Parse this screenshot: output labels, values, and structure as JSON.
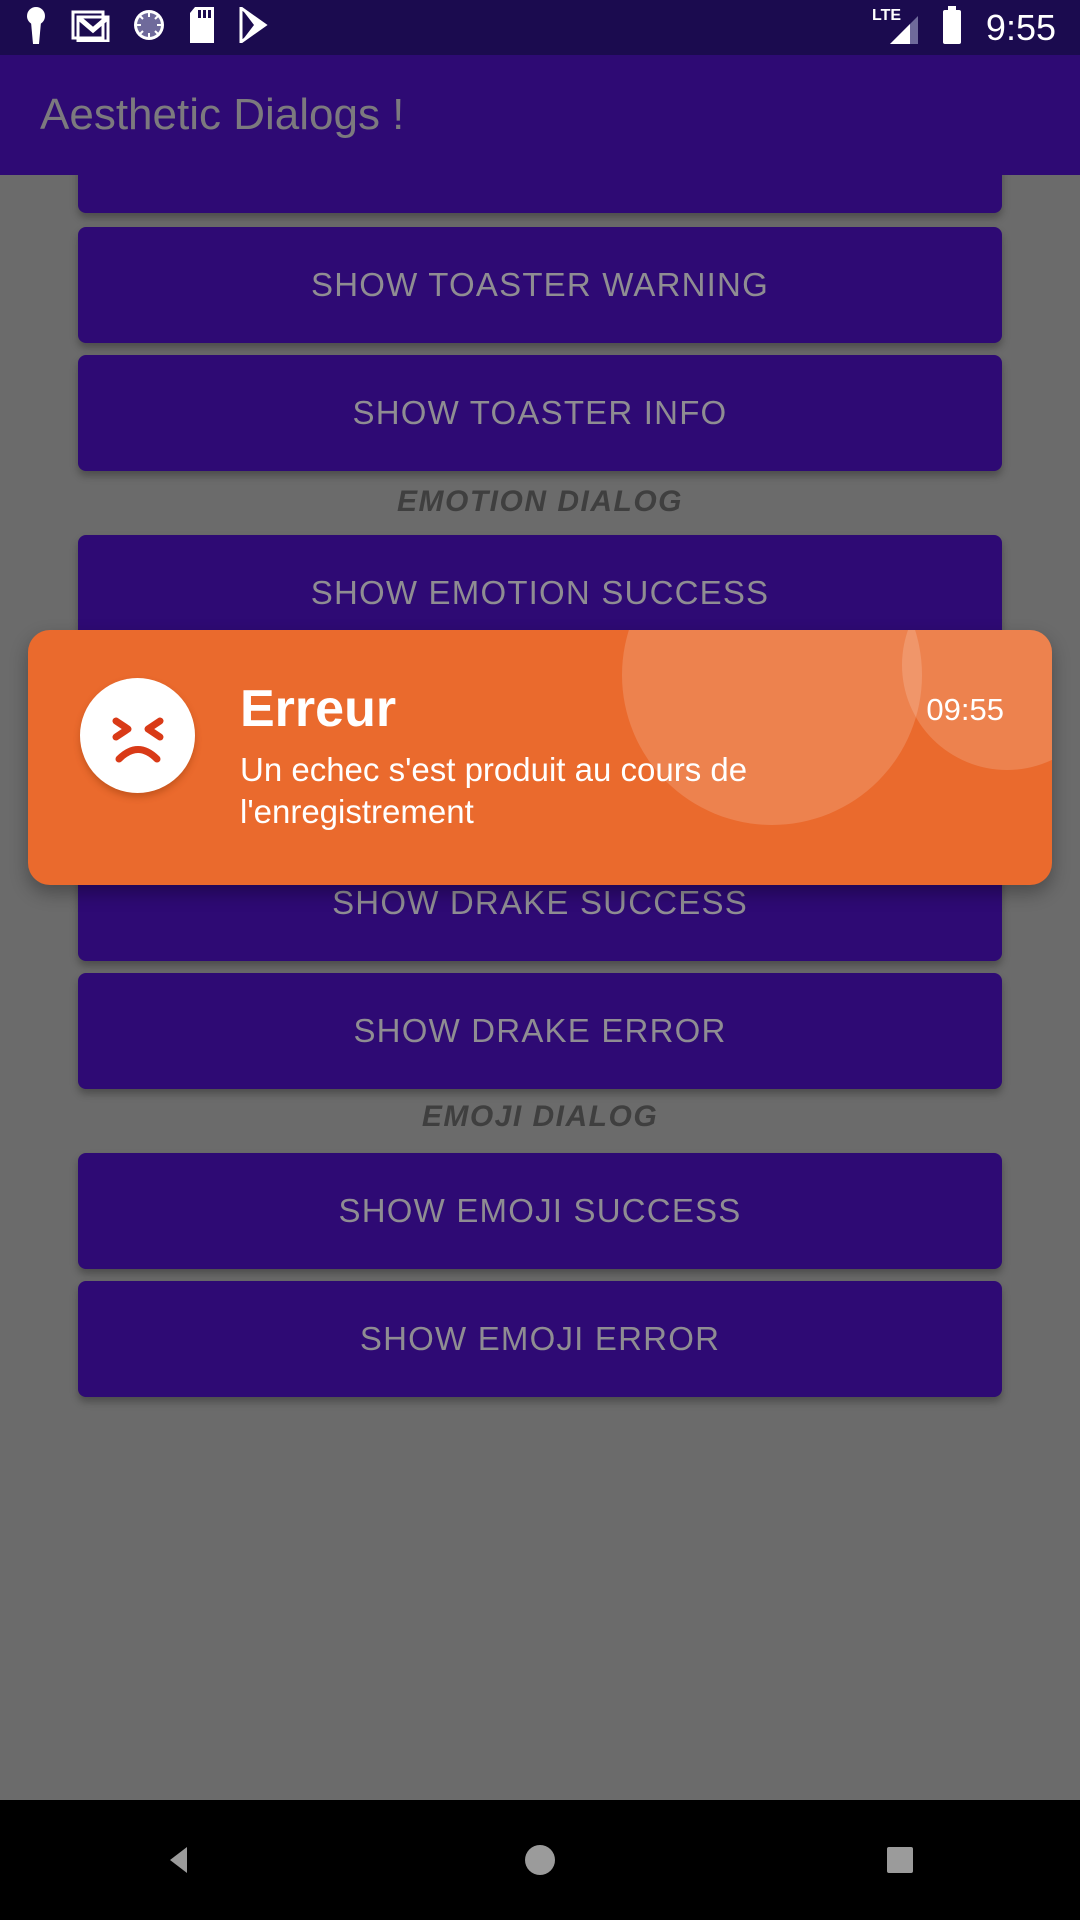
{
  "status_bar": {
    "clock": "9:55",
    "network_type": "LTE",
    "icons": [
      "keyhole-icon",
      "gmail-icon",
      "sync-spinner-icon",
      "sd-card-icon",
      "play-store-icon"
    ],
    "right_icons": [
      "signal-strength-icon",
      "battery-full-icon"
    ]
  },
  "app_bar": {
    "title": "Aesthetic Dialogs !"
  },
  "content": {
    "items": [
      {
        "kind": "button",
        "label": "",
        "partial": true
      },
      {
        "kind": "button",
        "label": "SHOW TOASTER WARNING"
      },
      {
        "kind": "button",
        "label": "SHOW TOASTER INFO"
      },
      {
        "kind": "section",
        "label": "EMOTION DIALOG"
      },
      {
        "kind": "button",
        "label": "SHOW EMOTION SUCCESS"
      },
      {
        "kind": "button",
        "label": "SHOW DRAKE SUCCESS"
      },
      {
        "kind": "button",
        "label": "SHOW DRAKE ERROR"
      },
      {
        "kind": "section",
        "label": "EMOJI DIALOG"
      },
      {
        "kind": "button",
        "label": "SHOW EMOJI SUCCESS"
      },
      {
        "kind": "button",
        "label": "SHOW EMOJI ERROR"
      }
    ]
  },
  "toast": {
    "title": "Erreur",
    "message": "Un echec s'est produit au cours de l'enregistrement",
    "time": "09:55",
    "icon": "sad-squint-face-icon",
    "background_color": "#ea6a2d",
    "text_color": "#ffffff"
  },
  "nav_bar": {
    "buttons": [
      "back-icon",
      "home-icon",
      "recents-icon"
    ]
  },
  "colors": {
    "status_bar": "#1b0b4f",
    "app_bar": "#2e0a74",
    "button": "#2e0a74",
    "scrim": "#6b6b6b",
    "accent_orange": "#ea6a2d",
    "nav_bar": "#000000"
  }
}
